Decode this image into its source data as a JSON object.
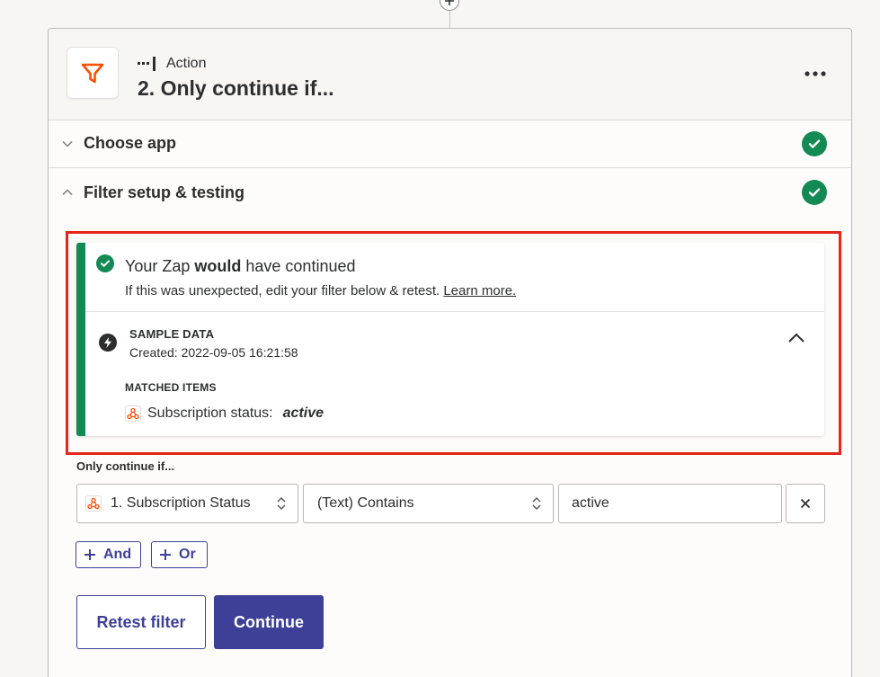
{
  "step": {
    "kind_label": "Action",
    "title": "2. Only continue if...",
    "app_icon": "filter-icon",
    "brand_color": "#ff4f00"
  },
  "sections": [
    {
      "label": "Choose app",
      "expanded": false,
      "status": "complete"
    },
    {
      "label": "Filter setup & testing",
      "expanded": true,
      "status": "complete"
    }
  ],
  "result": {
    "title_prefix": "Your Zap ",
    "title_bold": "would",
    "title_suffix": " have continued",
    "subtitle": "If this was unexpected, edit your filter below & retest.",
    "learn_more": "Learn more.",
    "sample_label": "SAMPLE DATA",
    "created": "Created: 2022-09-05 16:21:58",
    "matched_label": "MATCHED ITEMS",
    "matched_items": [
      {
        "field": "Subscription status:",
        "value": "active"
      }
    ]
  },
  "filter": {
    "label": "Only continue if...",
    "field": "1. Subscription Status",
    "condition": "(Text) Contains",
    "value": "active",
    "and_label": "And",
    "or_label": "Or"
  },
  "buttons": {
    "retest": "Retest filter",
    "continue": "Continue"
  },
  "colors": {
    "success": "#138953",
    "primary": "#3e4097",
    "highlight": "#e3251b",
    "webhook": "#ff4a00"
  }
}
